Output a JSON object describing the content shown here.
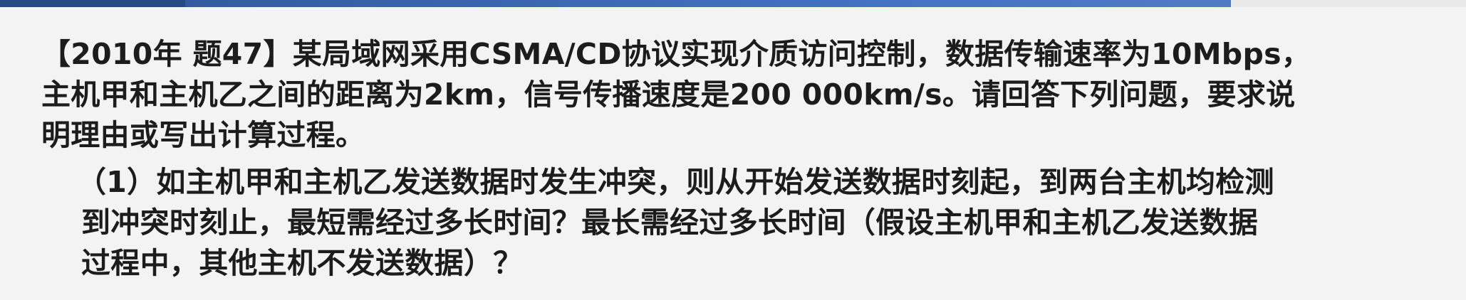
{
  "question": {
    "lines": [
      "【2010年 题47】某局域网采用CSMA/CD协议实现介质访问控制，数据传输速率为10Mbps，",
      "主机甲和主机乙之间的距离为2km，信号传播速度是200 000km/s。请回答下列问题，要求说",
      "明理由或写出计算过程。"
    ]
  },
  "sub_question": {
    "lines": [
      "（1）如主机甲和主机乙发送数据时发生冲突，则从开始发送数据时刻起，到两台主机均检测",
      "到冲突时刻止，最短需经过多长时间？最长需经过多长时间（假设主机甲和主机乙发送数据",
      "过程中，其他主机不发送数据）？"
    ]
  }
}
